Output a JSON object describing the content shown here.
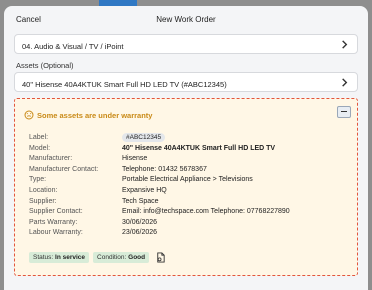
{
  "header": {
    "cancel_label": "Cancel",
    "title": "New Work Order"
  },
  "category_select": {
    "value": "04. Audio & Visual / TV / iPoint",
    "icon": "chevron-right-icon"
  },
  "assets": {
    "label": "Assets (Optional)",
    "value": "40\" Hisense 40A4KTUK Smart Full HD LED TV (#ABC12345)",
    "icon": "chevron-right-icon"
  },
  "warranty": {
    "title": "Some assets are under warranty",
    "icon": "warning-circle-icon",
    "details": [
      {
        "label": "Label:",
        "value": "#ABC12345"
      },
      {
        "label": "Model:",
        "value": "40\" Hisense 40A4KTUK Smart Full HD LED TV"
      },
      {
        "label": "Manufacturer:",
        "value": "Hisense"
      },
      {
        "label": "Manufacturer Contact:",
        "value": "Telephone: 01432 5678367"
      },
      {
        "label": "Type:",
        "value": "Portable Electrical Appliance > Televisions"
      },
      {
        "label": "Location:",
        "value": "Expansive HQ"
      },
      {
        "label": "Supplier:",
        "value": "Tech Space"
      },
      {
        "label": "Supplier Contact:",
        "value": "Email: info@techspace.com Telephone: 07768227890"
      },
      {
        "label": "Parts Warranty:",
        "value": "30/06/2026"
      },
      {
        "label": "Labour Warranty:",
        "value": "23/06/2026"
      }
    ],
    "status": {
      "label": "Status:",
      "value": "In service"
    },
    "condition": {
      "label": "Condition:",
      "value": "Good"
    },
    "document_icon": "document-icon"
  },
  "colors": {
    "warning_text": "#c98a17",
    "warning_border": "#e2553d",
    "warning_bg": "#fff7e6",
    "badge_bg": "#d8ecd8",
    "accent": "#2f78c4"
  }
}
